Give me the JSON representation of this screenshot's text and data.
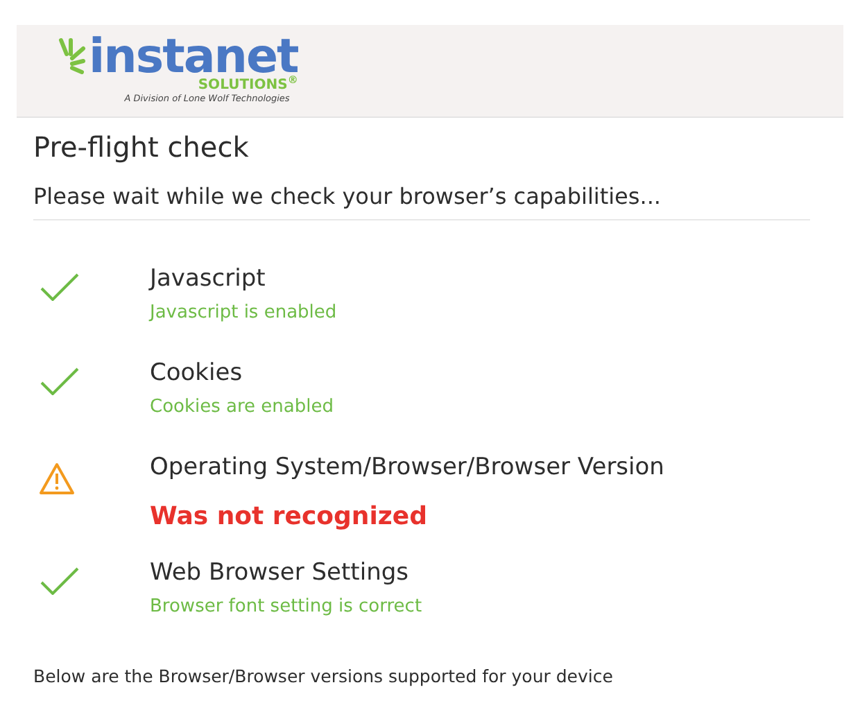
{
  "logo": {
    "name": "instanet",
    "suffix": "SOLUTIONS$^{®}$",
    "tagline": "A Division of Lone Wolf Technologies"
  },
  "title": "Pre-flight check",
  "subtitle": "Please wait while we check your browser’s capabilities...",
  "checks": [
    {
      "kind": "pass",
      "name": "Javascript",
      "status": "Javascript is enabled"
    },
    {
      "kind": "pass",
      "name": "Cookies",
      "status": "Cookies are enabled"
    },
    {
      "kind": "warning",
      "name": "Operating System/Browser/Browser Version",
      "status": "Was not recognized"
    },
    {
      "kind": "pass",
      "name": "Web Browser Settings",
      "status": "Browser font setting is correct"
    }
  ],
  "footer": "Below are the Browser/Browser versions supported for your device"
}
